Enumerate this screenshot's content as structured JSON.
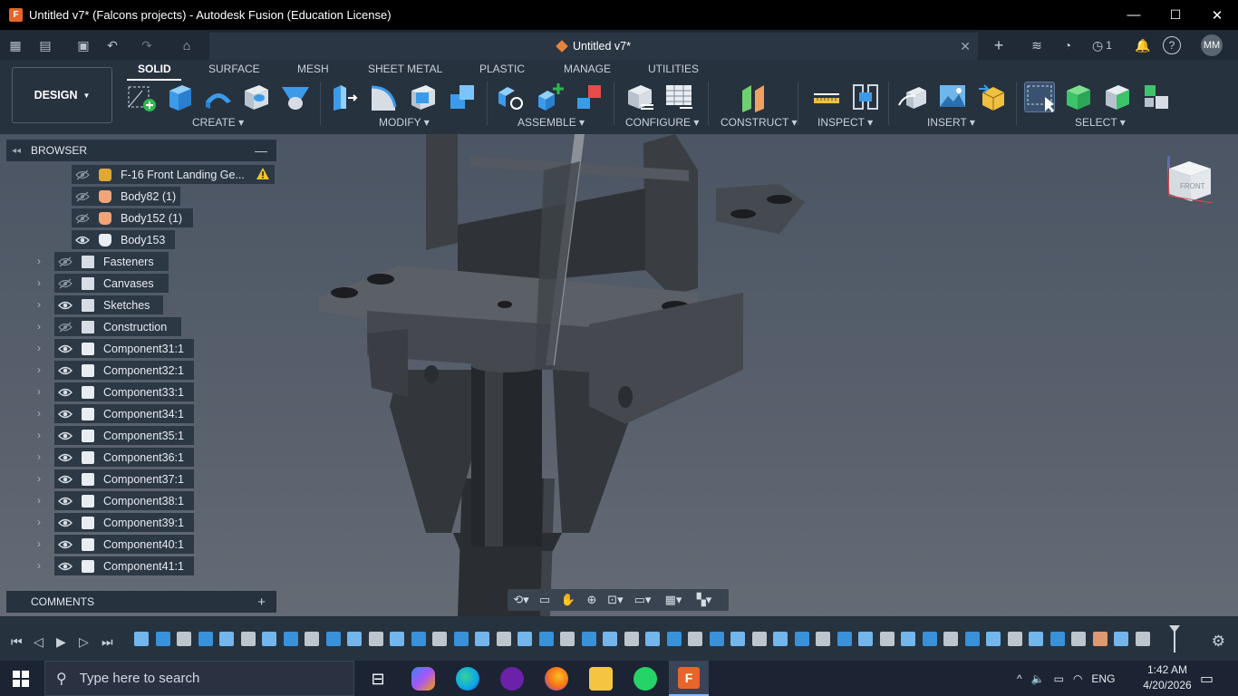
{
  "window": {
    "title": "Untitled v7* (Falcons projects) - Autodesk Fusion (Education License)",
    "minimize": "—",
    "maximize": "☐",
    "close": "✕"
  },
  "tabbar": {
    "doc_tab": "Untitled v7*",
    "close": "✕",
    "jobs_count": "1",
    "avatar": "MM",
    "add": "+",
    "help": "?"
  },
  "toolbar": {
    "workspace": "DESIGN",
    "tabs": [
      "SOLID",
      "SURFACE",
      "MESH",
      "SHEET METAL",
      "PLASTIC",
      "MANAGE",
      "UTILITIES"
    ],
    "groups": {
      "create": "CREATE",
      "modify": "MODIFY",
      "assemble": "ASSEMBLE",
      "configure": "CONFIGURE",
      "construct": "CONSTRUCT",
      "inspect": "INSPECT",
      "insert": "INSERT",
      "select": "SELECT"
    }
  },
  "browser": {
    "title": "BROWSER",
    "items": [
      {
        "label": "F-16 Front Landing Ge...",
        "icon": "assembly-icon",
        "visible": false,
        "warning": true
      },
      {
        "label": "Body82 (1)",
        "icon": "body-icon",
        "visible": false
      },
      {
        "label": "Body152 (1)",
        "icon": "body-icon",
        "visible": false
      },
      {
        "label": "Body153",
        "icon": "body-icon",
        "visible": true
      },
      {
        "label": "Fasteners",
        "icon": "folder-icon",
        "visible": false
      },
      {
        "label": "Canvases",
        "icon": "folder-icon",
        "visible": false
      },
      {
        "label": "Sketches",
        "icon": "folder-icon",
        "visible": true
      },
      {
        "label": "Construction",
        "icon": "folder-icon",
        "visible": false
      },
      {
        "label": "Component31:1",
        "icon": "component-icon",
        "visible": true
      },
      {
        "label": "Component32:1",
        "icon": "component-icon",
        "visible": true
      },
      {
        "label": "Component33:1",
        "icon": "component-icon",
        "visible": true
      },
      {
        "label": "Component34:1",
        "icon": "component-icon",
        "visible": true
      },
      {
        "label": "Component35:1",
        "icon": "component-icon",
        "visible": true
      },
      {
        "label": "Component36:1",
        "icon": "component-icon",
        "visible": true
      },
      {
        "label": "Component37:1",
        "icon": "component-icon",
        "visible": true
      },
      {
        "label": "Component38:1",
        "icon": "component-icon",
        "visible": true
      },
      {
        "label": "Component39:1",
        "icon": "component-icon",
        "visible": true
      },
      {
        "label": "Component40:1",
        "icon": "component-icon",
        "visible": true
      },
      {
        "label": "Component41:1",
        "icon": "component-icon",
        "visible": true
      }
    ]
  },
  "comments": {
    "title": "COMMENTS",
    "add": "+"
  },
  "viewcube": {
    "face": "FRONT"
  },
  "taskbar": {
    "search_placeholder": "Type here to search",
    "language": "ENG",
    "time": "1:42 AM",
    "date": "4/20/2026"
  },
  "colors": {
    "titlebar": "#000000",
    "toolbar": "#27323f",
    "panel_row": "#2d3845",
    "viewport_top": "#4b5563",
    "accent_orange": "#e8642a",
    "body_orange": "#f2a477",
    "create_blue": "#3b9bea",
    "select_green": "#3cc46a"
  }
}
